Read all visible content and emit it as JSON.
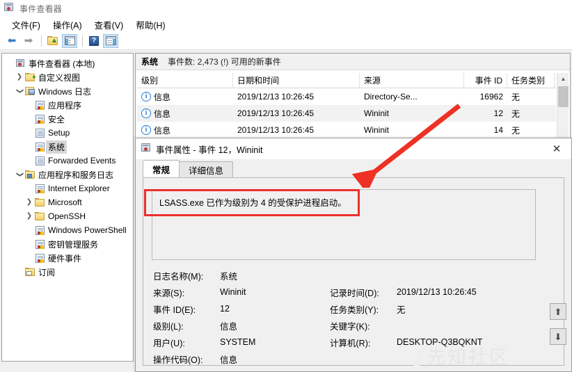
{
  "window": {
    "title": "事件查看器",
    "icon": "event-viewer-icon"
  },
  "menu": {
    "items": [
      {
        "label": "文件(F)"
      },
      {
        "label": "操作(A)"
      },
      {
        "label": "查看(V)"
      },
      {
        "label": "帮助(H)"
      }
    ]
  },
  "toolbar": {
    "back": "◀",
    "forward": "▶",
    "help_glyph": "?",
    "items": [
      {
        "name": "back-icon",
        "label": "◀"
      },
      {
        "name": "forward-icon",
        "label": "▶"
      },
      {
        "name": "up-folder-icon",
        "label": ""
      },
      {
        "name": "show-console-tree-icon",
        "label": ""
      },
      {
        "name": "help-icon",
        "label": "?"
      },
      {
        "name": "show-action-pane-icon",
        "label": ""
      }
    ]
  },
  "sidebar": {
    "items": [
      {
        "label": "事件查看器 (本地)",
        "indent": 0,
        "twisty": "",
        "icon": "event-viewer-icon",
        "selected": false
      },
      {
        "label": "自定义视图",
        "indent": 1,
        "twisty": "›",
        "icon": "custom-view-folder-icon",
        "selected": false
      },
      {
        "label": "Windows 日志",
        "indent": 1,
        "twisty": "ˇ",
        "icon": "windows-logs-icon",
        "selected": false
      },
      {
        "label": "应用程序",
        "indent": 2,
        "twisty": "",
        "icon": "log-icon",
        "selected": false
      },
      {
        "label": "安全",
        "indent": 2,
        "twisty": "",
        "icon": "log-icon",
        "selected": false
      },
      {
        "label": "Setup",
        "indent": 2,
        "twisty": "",
        "icon": "log-plain-icon",
        "selected": false
      },
      {
        "label": "系统",
        "indent": 2,
        "twisty": "",
        "icon": "log-icon",
        "selected": true
      },
      {
        "label": "Forwarded Events",
        "indent": 2,
        "twisty": "",
        "icon": "log-plain-icon",
        "selected": false
      },
      {
        "label": "应用程序和服务日志",
        "indent": 1,
        "twisty": "ˇ",
        "icon": "app-service-logs-icon",
        "selected": false
      },
      {
        "label": "Internet Explorer",
        "indent": 2,
        "twisty": "",
        "icon": "log-icon",
        "selected": false
      },
      {
        "label": "Microsoft",
        "indent": 2,
        "twisty": "›",
        "icon": "folder-icon",
        "selected": false
      },
      {
        "label": "OpenSSH",
        "indent": 2,
        "twisty": "›",
        "icon": "folder-icon",
        "selected": false
      },
      {
        "label": "Windows PowerShell",
        "indent": 2,
        "twisty": "",
        "icon": "log-icon",
        "selected": false
      },
      {
        "label": "密钥管理服务",
        "indent": 2,
        "twisty": "",
        "icon": "log-icon",
        "selected": false
      },
      {
        "label": "硬件事件",
        "indent": 2,
        "twisty": "",
        "icon": "log-icon",
        "selected": false
      },
      {
        "label": "订阅",
        "indent": 1,
        "twisty": "",
        "icon": "subscriptions-icon",
        "selected": false
      }
    ]
  },
  "list": {
    "header_name": "系统",
    "header_count": "事件数: 2,473 (!) 可用的新事件",
    "columns": [
      {
        "label": "级别",
        "width": 138,
        "align": "left"
      },
      {
        "label": "日期和时间",
        "width": 182,
        "align": "left"
      },
      {
        "label": "来源",
        "width": 150,
        "align": "left"
      },
      {
        "label": "事件 ID",
        "width": 62,
        "align": "right"
      },
      {
        "label": "任务类别",
        "width": 68,
        "align": "left"
      }
    ],
    "rows": [
      {
        "level": "信息",
        "level_icon": "information-icon",
        "datetime": "2019/12/13 10:26:45",
        "source": "Directory-Se...",
        "event_id": "16962",
        "task_category": "无"
      },
      {
        "level": "信息",
        "level_icon": "information-icon",
        "datetime": "2019/12/13 10:26:45",
        "source": "Wininit",
        "event_id": "12",
        "task_category": "无"
      },
      {
        "level": "信息",
        "level_icon": "information-icon",
        "datetime": "2019/12/13 10:26:45",
        "source": "Wininit",
        "event_id": "14",
        "task_category": "无"
      }
    ],
    "info_glyph": "i"
  },
  "dialog": {
    "title": "事件属性 - 事件 12，Wininit",
    "close_glyph": "✕",
    "tabs": [
      {
        "label": "常规",
        "active": true
      },
      {
        "label": "详细信息",
        "active": false
      }
    ],
    "description": "LSASS.exe 已作为级别为 4 的受保护进程启动。",
    "fields": [
      {
        "label": "日志名称(M):",
        "value": "系统",
        "label2": "",
        "value2": ""
      },
      {
        "label": "来源(S):",
        "value": "Wininit",
        "label2": "记录时间(D):",
        "value2": "2019/12/13 10:26:45"
      },
      {
        "label": "事件 ID(E):",
        "value": "12",
        "label2": "任务类别(Y):",
        "value2": "无"
      },
      {
        "label": "级别(L):",
        "value": "信息",
        "label2": "关键字(K):",
        "value2": ""
      },
      {
        "label": "用户(U):",
        "value": "SYSTEM",
        "label2": "计算机(R):",
        "value2": "DESKTOP-Q3BQKNT"
      },
      {
        "label": "操作代码(O):",
        "value": "信息",
        "label2": "",
        "value2": ""
      }
    ],
    "nav_up": "⬆",
    "nav_down": "⬇"
  },
  "watermark": {
    "text": "先知社区"
  },
  "annotation": {
    "box_color": "#ec2f2f",
    "arrow_color": "#ee3124"
  }
}
